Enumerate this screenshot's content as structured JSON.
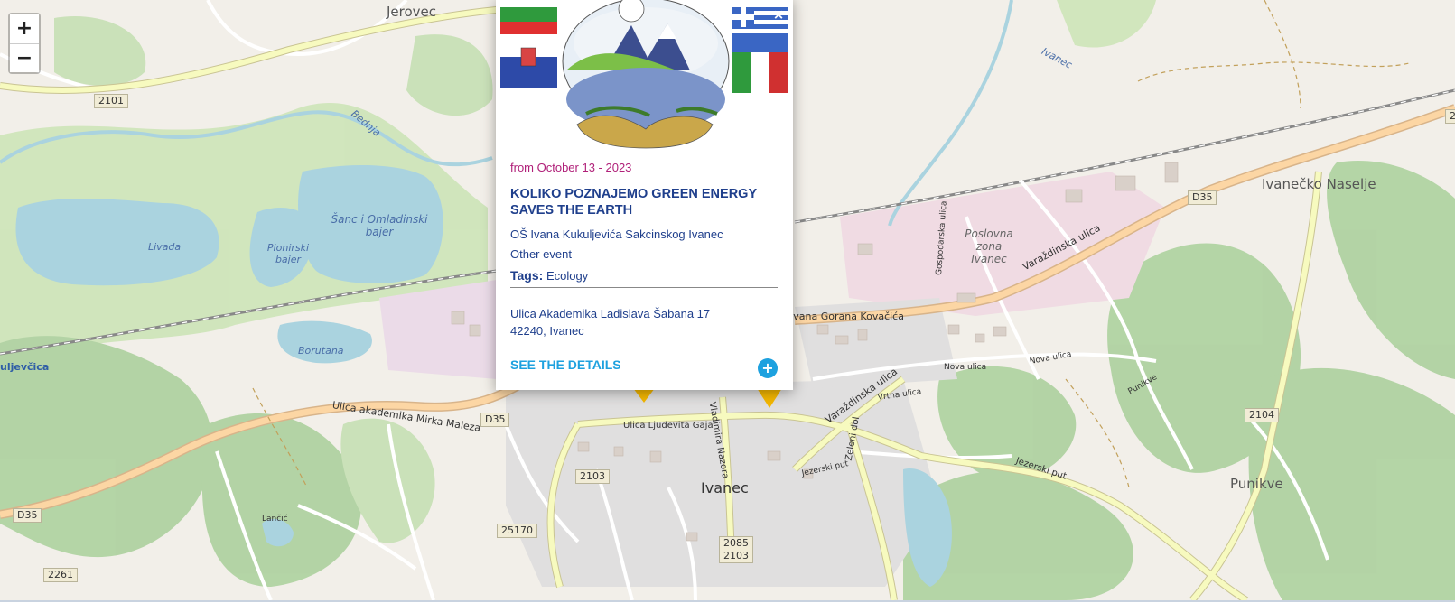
{
  "map": {
    "zoom_in": "+",
    "zoom_out": "−",
    "place_labels": {
      "jerovec": "Jerovec",
      "ivanecko_naselje": "Ivanečko Naselje",
      "ivanec": "Ivanec",
      "punikve": "Punikve",
      "kuljevcica": "uljevčica",
      "poslovna_zona": "Poslovna zona Ivanec",
      "ivanec_river": "Ivanec"
    },
    "water_labels": {
      "sanc": "Šanc i Omladinski bajer",
      "pionirski": "Pionirski bajer",
      "livada": "Livada",
      "borutana": "Borutana",
      "bednja": "Bednja"
    },
    "street_labels": {
      "mirka_maleza": "Ulica akademika Mirka Maleza",
      "varazdinska_1": "Varaždinska ulica",
      "varazdinska_2": "Varaždinska ulica",
      "gorana_kovacica": "Ivana Gorana Kovačića",
      "ljudevita_gaja": "Ulica Ljudevita Gaja",
      "vladimira_nazora": "Vladimira Nazora",
      "zeleni_dol": "Zeleni dol",
      "jezerski_put_1": "Jezerski put",
      "jezerski_put_2": "Jezerski put",
      "nova_ulica_1": "Nova ulica",
      "nova_ulica_2": "Nova ulica",
      "vrtna_ulica": "Vrtna ulica",
      "gospodarska": "Gospodarska ulica",
      "punikve_st": "Punikve",
      "lancic": "Lančić"
    },
    "road_badges": [
      "2101",
      "D35",
      "D35",
      "2103",
      "25170",
      "2085\n2103",
      "2104",
      "D35",
      "2261",
      "2"
    ],
    "colors": {
      "land": "#f2efe9",
      "water": "#aad3df",
      "forest": "#add19e",
      "road": "#f7fabf",
      "primary": "#fcd6a4",
      "marker": "#f5b800"
    }
  },
  "popup": {
    "close": "×",
    "date": "from October 13 - 2023",
    "title": "KOLIKO POZNAJEMO GREEN ENERGY SAVES THE EARTH",
    "organizer": "OŠ Ivana Kukuljevića Sakcinskog Ivanec",
    "event_type": "Other event",
    "tags_label": "Tags:",
    "tags_value": "Ecology",
    "address_line1": "Ulica Akademika Ladislava Šabana 17",
    "address_line2": "42240, Ivanec",
    "details_link": "SEE THE DETAILS",
    "details_icon": "+"
  }
}
